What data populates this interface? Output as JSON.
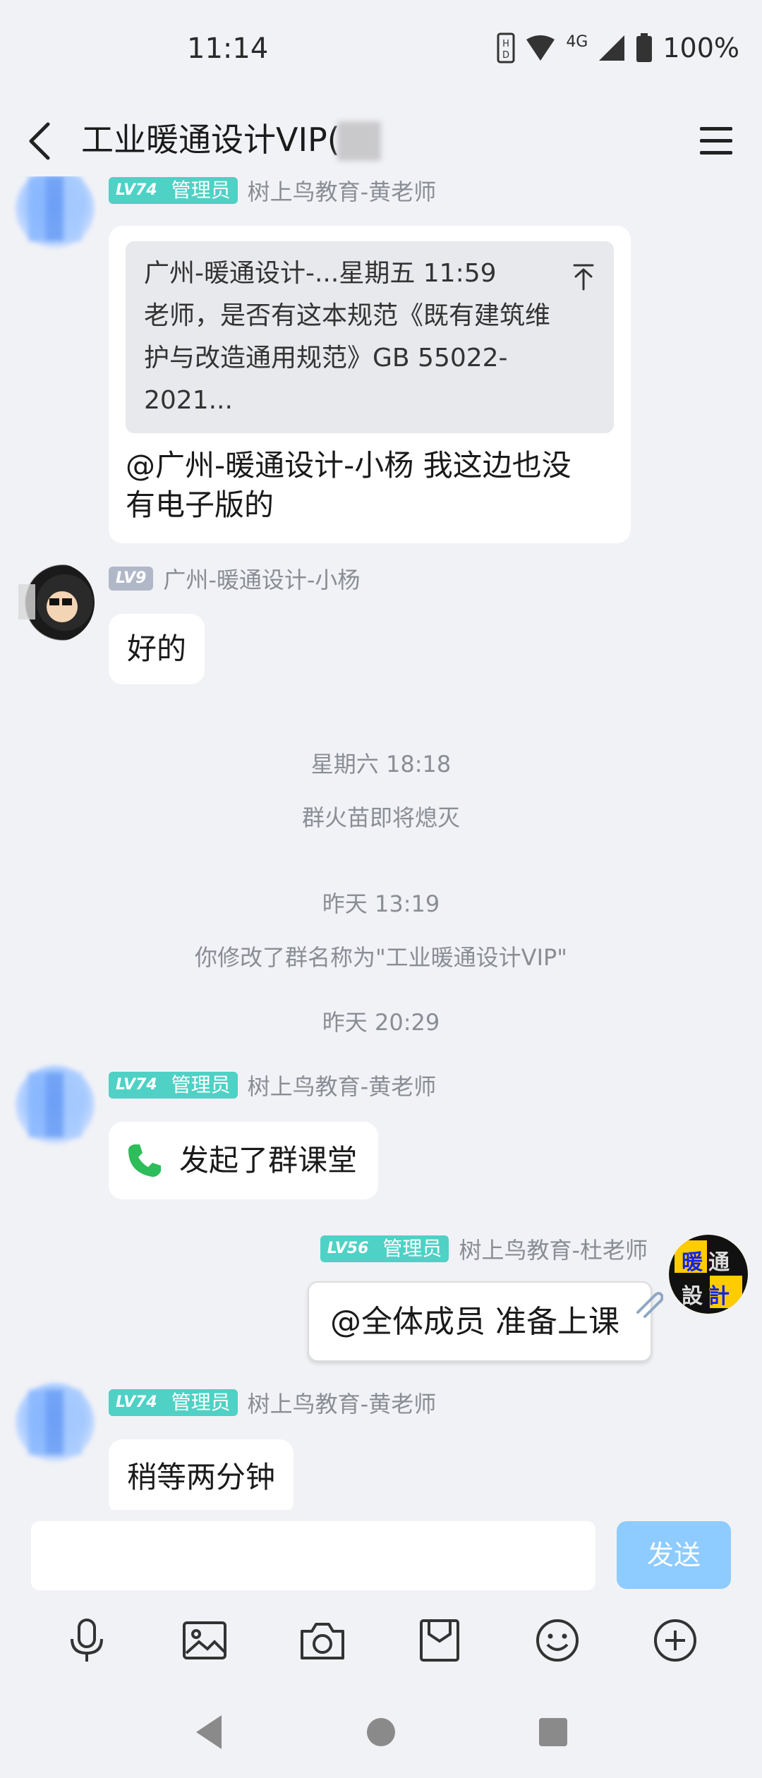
{
  "status_bar": {
    "time": "11:14",
    "network": "4G",
    "battery": "100%"
  },
  "header": {
    "title": "工业暖通设计VIP("
  },
  "messages": {
    "m1": {
      "level": "LV74",
      "role": "管理员",
      "sender": "树上鸟教育-黄老师",
      "quote_sender": "广州-暖通设计-...",
      "quote_time": "星期五 11:59",
      "quote_line1": "老师，是否有这本规范《既有建筑维",
      "quote_line2": "护与改造通用规范》GB 55022-2021...",
      "text_line1": "@广州-暖通设计-小杨 我这边也没",
      "text_line2": "有电子版的"
    },
    "m2": {
      "level": "LV9",
      "sender": "广州-暖通设计-小杨",
      "text": "好的"
    },
    "sys1": {
      "time": "星期六 18:18",
      "note": "群火苗即将熄灭"
    },
    "sys2": {
      "time": "昨天 13:19",
      "note": "你修改了群名称为\"工业暖通设计VIP\""
    },
    "sys3": {
      "time": "昨天 20:29"
    },
    "m3": {
      "level": "LV74",
      "role": "管理员",
      "sender": "树上鸟教育-黄老师",
      "text": "发起了群课堂"
    },
    "m4": {
      "level": "LV56",
      "role": "管理员",
      "sender": "树上鸟教育-杜老师",
      "text": "@全体成员 准备上课",
      "avatar_text_top": "暖通",
      "avatar_text_bottom": "設計"
    },
    "m5": {
      "level": "LV74",
      "role": "管理员",
      "sender": "树上鸟教育-黄老师",
      "text": "稍等两分钟"
    }
  },
  "input": {
    "send_label": "发送"
  },
  "toolbar": [
    "mic-icon",
    "image-icon",
    "camera-icon",
    "folder-icon",
    "emoji-icon",
    "plus-icon"
  ],
  "colors": {
    "accent_badge": "#4fd1c5",
    "send_button": "#8ecbff",
    "call_green": "#2dbd5a"
  }
}
